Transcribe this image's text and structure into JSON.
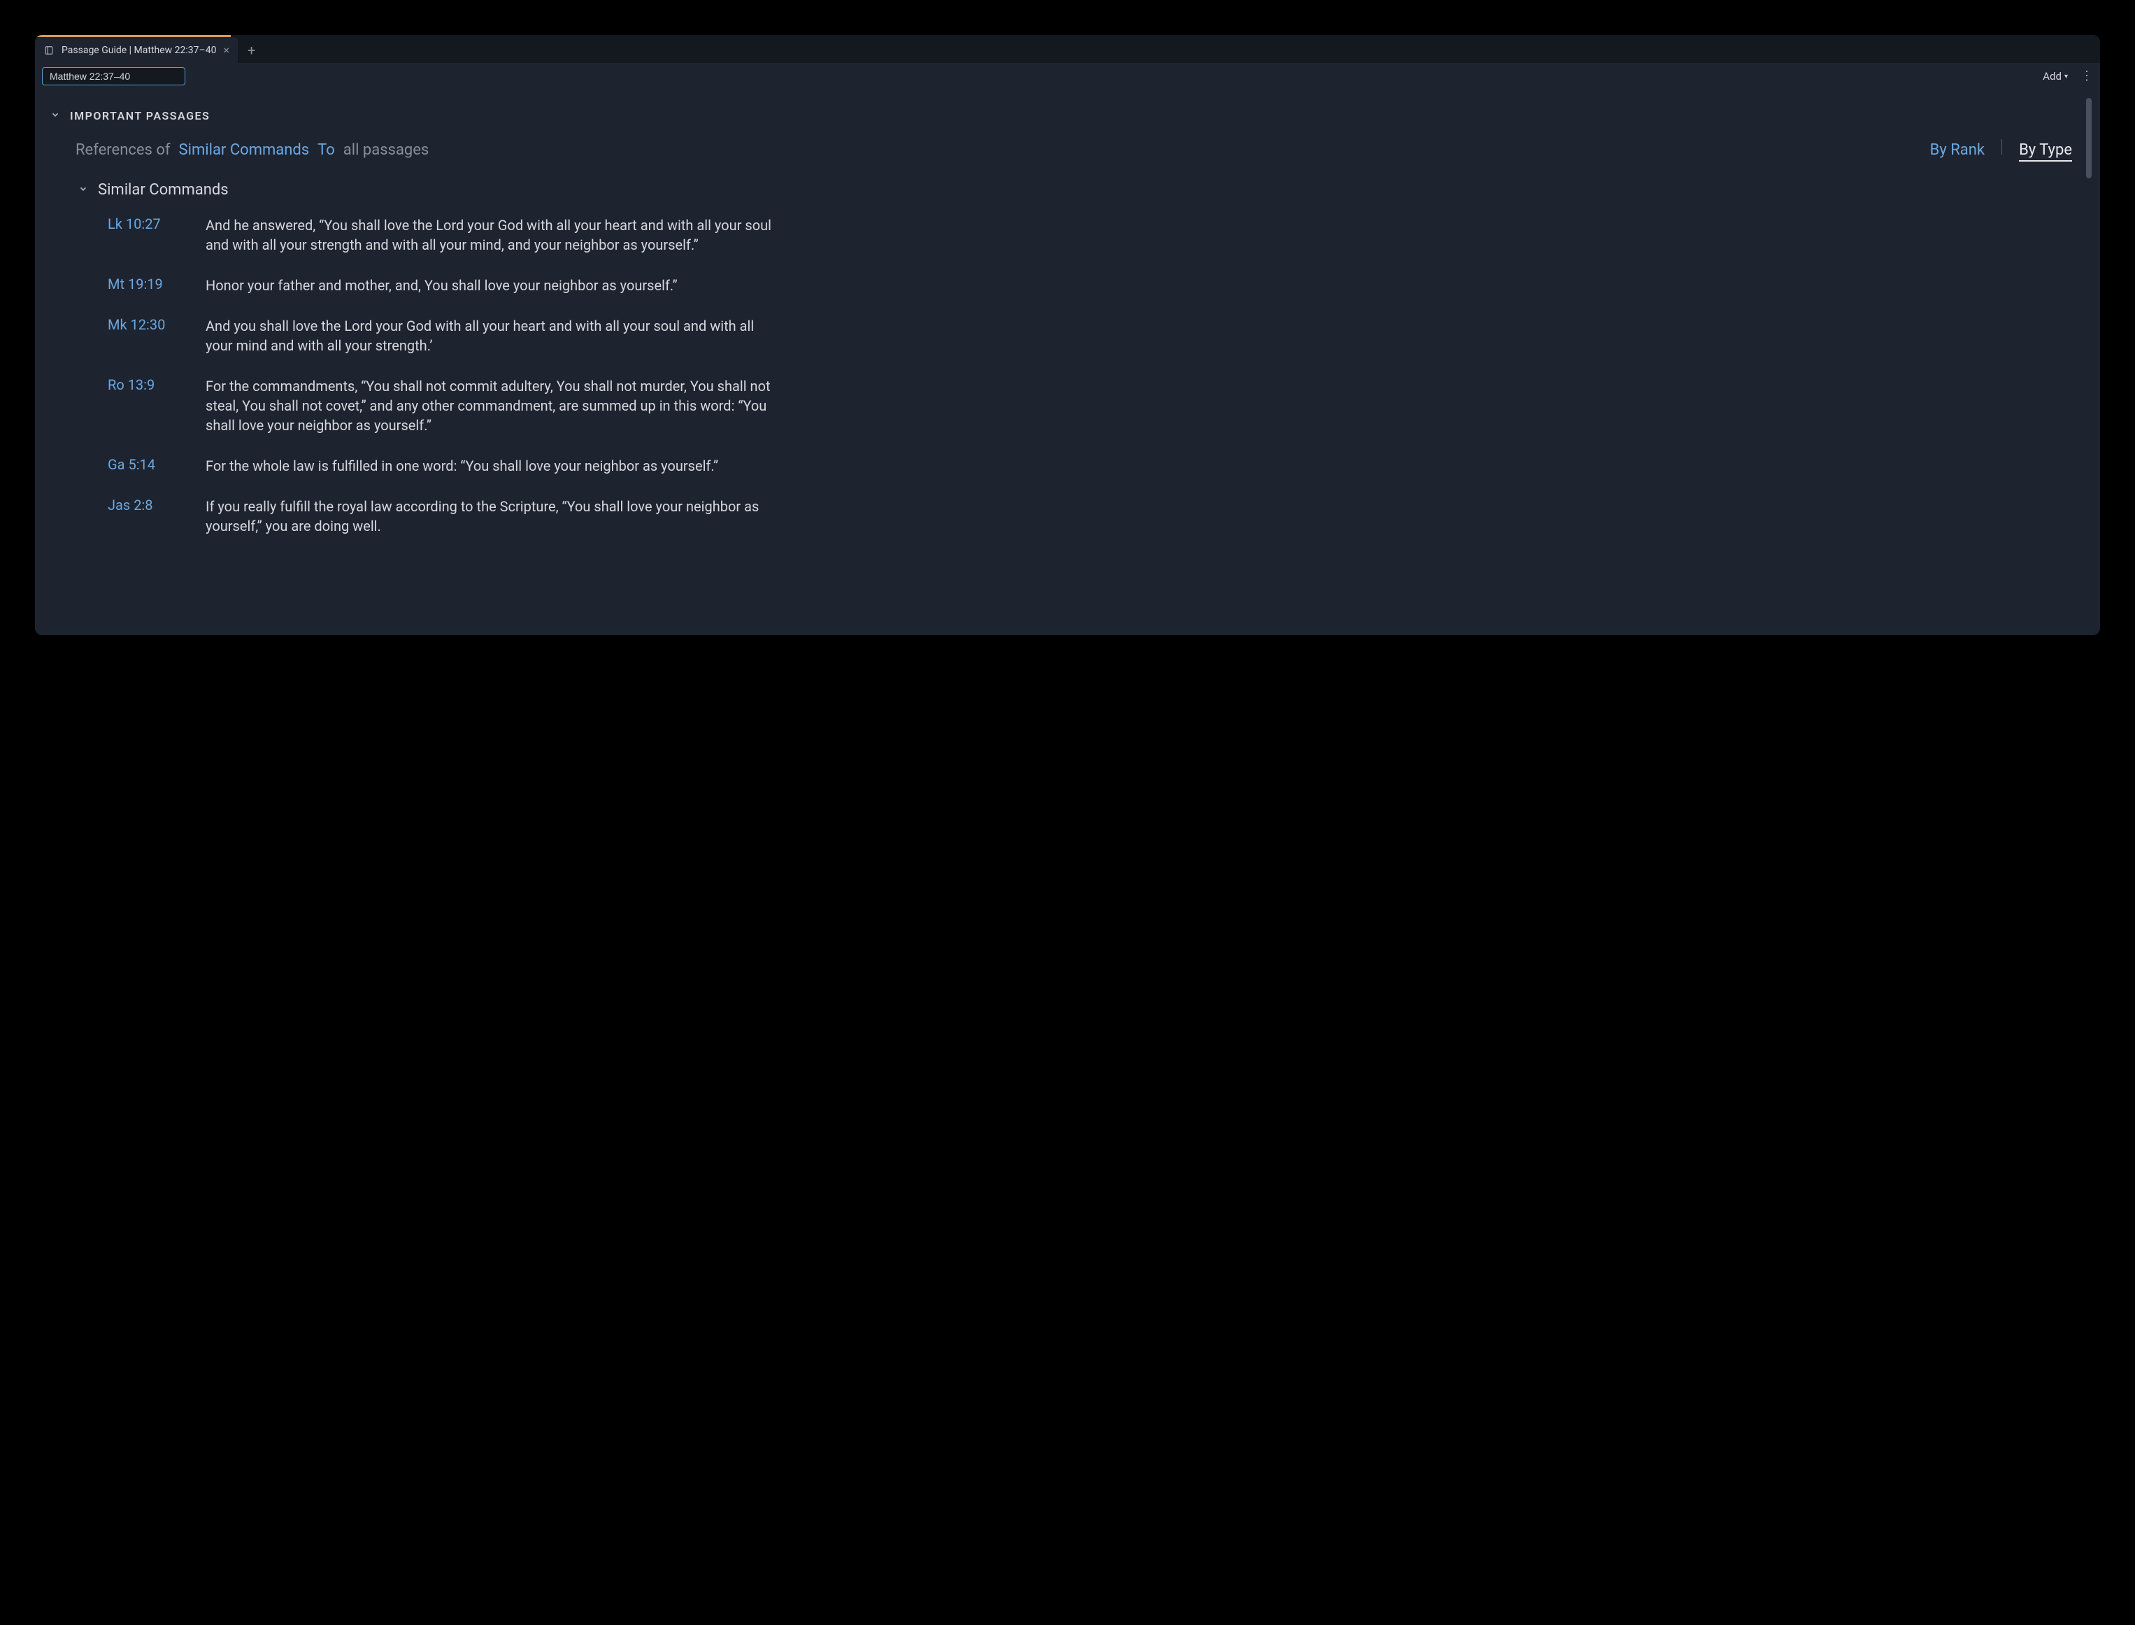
{
  "tab": {
    "title": "Passage Guide | Matthew 22:37–40"
  },
  "toolbar": {
    "passage_value": "Matthew 22:37–40",
    "add_label": "Add"
  },
  "section": {
    "title": "Important Passages"
  },
  "filter": {
    "references_of": "References of",
    "similar_commands": "Similar Commands",
    "to": "To",
    "all_passages": "all passages",
    "by_rank": "By Rank",
    "by_type": "By Type"
  },
  "subsection": {
    "title": "Similar Commands"
  },
  "passages": [
    {
      "ref": "Lk 10:27",
      "text": "And he answered, “You shall love the Lord your God with all your heart and with all your soul and with all your strength and with all your mind, and your neighbor as yourself.”"
    },
    {
      "ref": "Mt 19:19",
      "text": "Honor your father and mother, and, You shall love your neighbor as yourself.”"
    },
    {
      "ref": "Mk 12:30",
      "text": "And you shall love the Lord your God with all your heart and with all your soul and with all your mind and with all your strength.’"
    },
    {
      "ref": "Ro 13:9",
      "text": "For the commandments, “You shall not commit adultery, You shall not murder, You shall not steal, You shall not covet,” and any other commandment, are summed up in this word: “You shall love your neighbor as yourself.”"
    },
    {
      "ref": "Ga 5:14",
      "text": "For the whole law is fulfilled in one word: “You shall love your neighbor as yourself.”"
    },
    {
      "ref": "Jas 2:8",
      "text": "If you really fulfill the royal law according to the Scripture, “You shall love your neighbor as yourself,” you are doing well."
    }
  ]
}
